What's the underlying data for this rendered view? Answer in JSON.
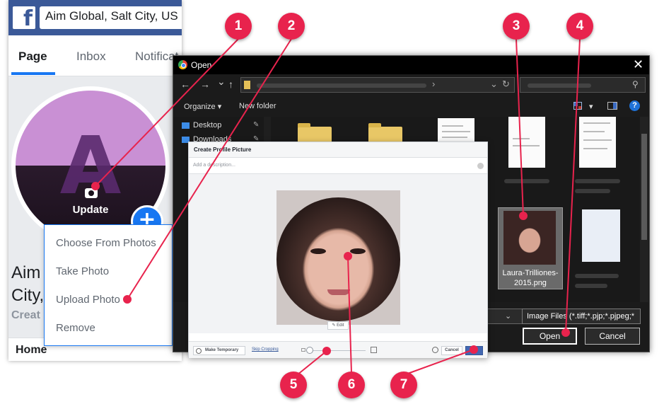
{
  "facebook": {
    "search_value": "Aim Global, Salt City, US",
    "tabs": [
      {
        "label": "Page"
      },
      {
        "label": "Inbox"
      },
      {
        "label": "Notificat"
      }
    ],
    "avatar_letter": "A",
    "update_label": "Update",
    "add_button": "+",
    "page_name_line1": "Aim",
    "page_name_line2": "City,",
    "create_label": "Creat",
    "home_label": "Home",
    "menu_items": [
      {
        "label": "Choose From Photos"
      },
      {
        "label": "Take Photo"
      },
      {
        "label": "Upload Photo"
      },
      {
        "label": "Remove"
      }
    ]
  },
  "open_dialog": {
    "title": "Open",
    "close": "✕",
    "nav": {
      "back": "←",
      "forward": "→",
      "recent": "⌄",
      "up": "↑",
      "refresh": "↻"
    },
    "toolbar": {
      "organize": "Organize ▾",
      "new_folder": "New folder",
      "view_dropdown": "▾",
      "help": "?"
    },
    "sidebar": [
      {
        "label": "Desktop"
      },
      {
        "label": "Downloads"
      }
    ],
    "selected_file": "Laura-Trilliones-2015.png",
    "file_type": "Image Files (*.tiff;*.pjp;*.pjpeg;*",
    "open_button": "Open",
    "cancel_button": "Cancel"
  },
  "profile_dialog": {
    "title": "Create Profile Picture",
    "description_placeholder": "Add a description...",
    "edit_label": "Edit",
    "make_temporary": "Make Temporary",
    "skip_cropping": "Skip Cropping",
    "cancel": "Cancel"
  },
  "callouts": [
    "1",
    "2",
    "3",
    "4",
    "5",
    "6",
    "7"
  ],
  "colors": {
    "callout": "#e8234d",
    "facebook_blue": "#3b5998",
    "accent_blue": "#1877f2"
  }
}
